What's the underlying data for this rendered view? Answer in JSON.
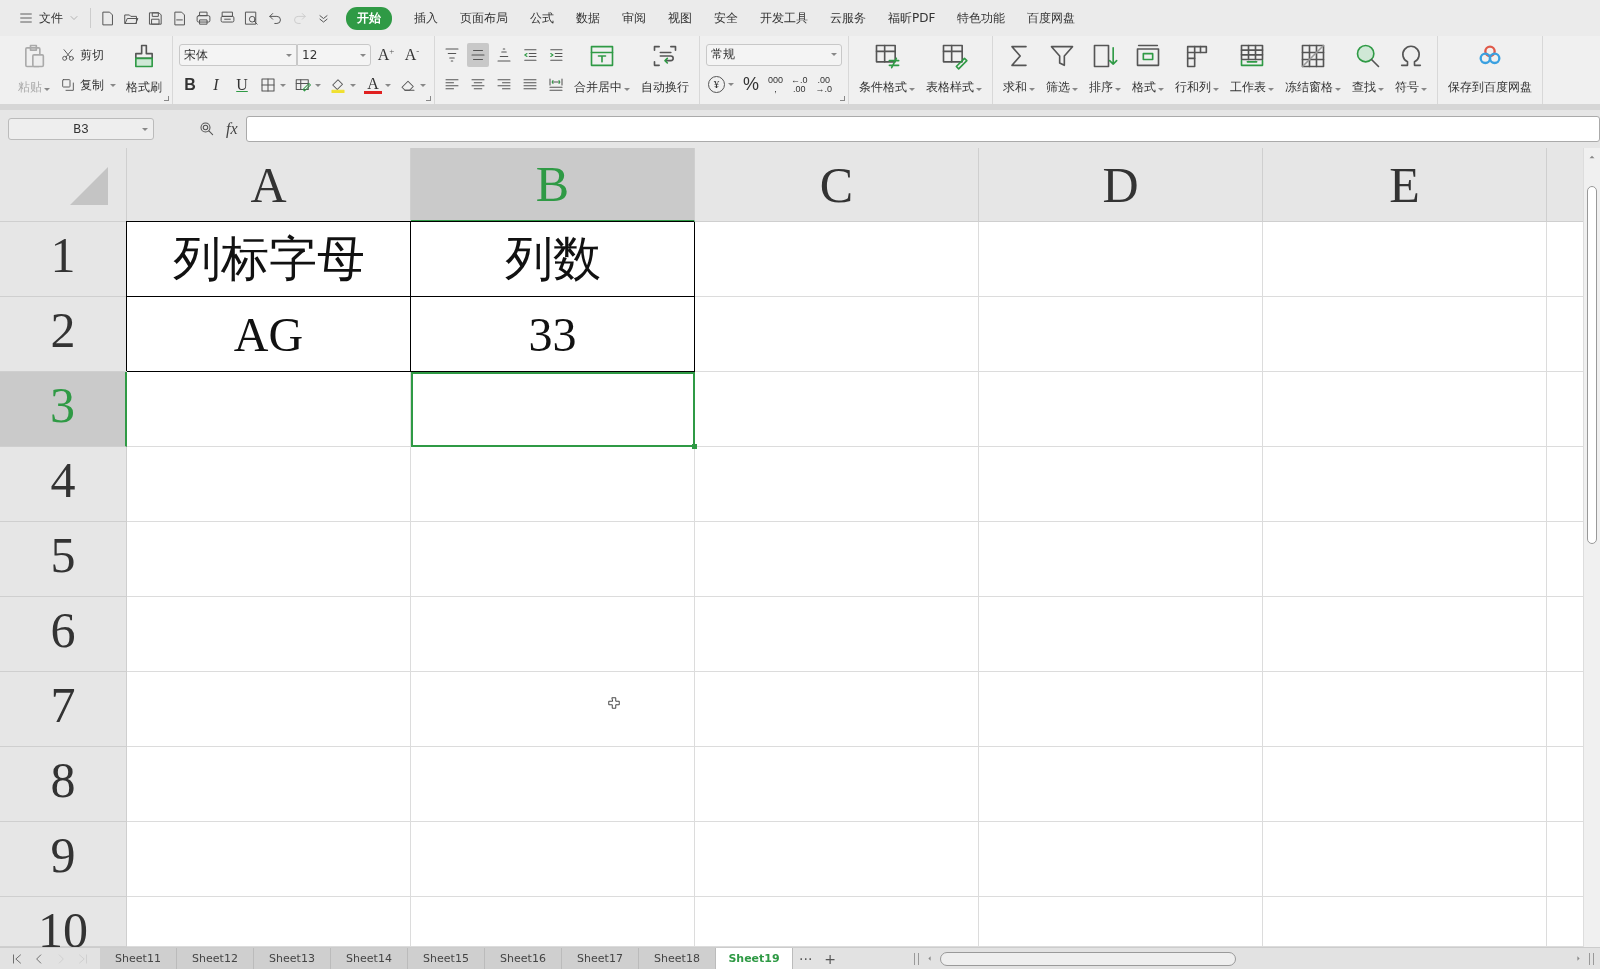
{
  "menu": {
    "file": "文件",
    "tabs": [
      {
        "label": "开始",
        "selected": true
      },
      {
        "label": "插入",
        "selected": false
      },
      {
        "label": "页面布局",
        "selected": false
      },
      {
        "label": "公式",
        "selected": false
      },
      {
        "label": "数据",
        "selected": false
      },
      {
        "label": "审阅",
        "selected": false
      },
      {
        "label": "视图",
        "selected": false
      },
      {
        "label": "安全",
        "selected": false
      },
      {
        "label": "开发工具",
        "selected": false
      },
      {
        "label": "云服务",
        "selected": false
      },
      {
        "label": "福昕PDF",
        "selected": false
      },
      {
        "label": "特色功能",
        "selected": false
      },
      {
        "label": "百度网盘",
        "selected": false
      }
    ]
  },
  "ribbon": {
    "groups": [
      {
        "launcher": true,
        "cols": [
          {
            "kind": "large",
            "label": "粘贴",
            "dropdown": true,
            "disabled": true
          },
          {
            "kind": "stack",
            "rows": [
              [
                {
                  "kind": "button",
                  "label": "剪切",
                  "dropdown": false
                }
              ],
              [
                {
                  "kind": "button",
                  "label": "复制",
                  "dropdown": true
                }
              ]
            ]
          },
          {
            "kind": "large",
            "label": "格式刷",
            "dropdown": false,
            "disabled": false
          }
        ]
      },
      {
        "launcher": true,
        "cols": [
          {
            "kind": "stack",
            "rows": [
              [
                {
                  "kind": "select",
                  "value": "宋体"
                },
                {
                  "kind": "select",
                  "value": "12"
                },
                {
                  "kind": "glyph",
                  "label": "A$^{+}$",
                  "dropdown": false
                },
                {
                  "kind": "glyph",
                  "label": "A$^{-}$",
                  "dropdown": false
                }
              ],
              [
                {
                  "kind": "bold",
                  "label": "B",
                  "dropdown": false
                },
                {
                  "kind": "italic",
                  "label": "I",
                  "dropdown": false
                },
                {
                  "kind": "underline",
                  "label": "U",
                  "dropdown": false
                },
                {
                  "kind": "tool",
                  "dropdown": true
                },
                {
                  "kind": "tool",
                  "dropdown": true
                },
                {
                  "kind": "tool",
                  "dropdown": true
                },
                {
                  "kind": "font-color",
                  "label": "A",
                  "dropdown": true
                },
                {
                  "kind": "tool",
                  "dropdown": true
                }
              ]
            ]
          }
        ]
      },
      {
        "cols": [
          {
            "kind": "stack",
            "rows": [
              [
                {
                  "kind": "tool",
                  "dropdown": false,
                  "pressed": false
                },
                {
                  "kind": "tool",
                  "dropdown": false,
                  "pressed": true
                },
                {
                  "kind": "tool",
                  "dropdown": false,
                  "pressed": false
                },
                {
                  "kind": "tool",
                  "dropdown": false,
                  "pressed": false
                },
                {
                  "kind": "tool",
                  "dropdown": false,
                  "pressed": false
                }
              ],
              [
                {
                  "kind": "tool",
                  "dropdown": false,
                  "pressed": false
                },
                {
                  "kind": "tool",
                  "dropdown": false,
                  "pressed": false
                },
                {
                  "kind": "tool",
                  "dropdown": false,
                  "pressed": false
                },
                {
                  "kind": "tool",
                  "dropdown": false,
                  "pressed": false
                },
                {
                  "kind": "tool",
                  "dropdown": false,
                  "pressed": false
                }
              ]
            ]
          },
          {
            "kind": "large",
            "label": "合并居中",
            "dropdown": true,
            "disabled": false
          },
          {
            "kind": "large",
            "label": "自动换行",
            "dropdown": false,
            "disabled": false
          }
        ]
      },
      {
        "launcher": true,
        "cols": [
          {
            "kind": "stack",
            "rows": [
              [
                {
                  "kind": "select",
                  "value": "常规"
                }
              ],
              [
                {
                  "kind": "currency",
                  "label": "¥",
                  "dropdown": true
                },
                {
                  "kind": "percent",
                  "label": "%",
                  "dropdown": false
                },
                {
                  "kind": "lines",
                  "lines": [
                    "000",
                    ","
                  ]
                },
                {
                  "kind": "lines",
                  "lines": [
                    "←.0",
                    ".00"
                  ]
                },
                {
                  "kind": "lines",
                  "lines": [
                    ".00",
                    "→.0"
                  ]
                }
              ]
            ]
          }
        ]
      },
      {
        "cols": [
          {
            "kind": "large",
            "label": "条件格式",
            "dropdown": true,
            "disabled": false
          },
          {
            "kind": "large",
            "label": "表格样式",
            "dropdown": true,
            "disabled": false
          }
        ]
      },
      {
        "cols": [
          {
            "kind": "large",
            "label": "求和",
            "dropdown": true,
            "disabled": false
          },
          {
            "kind": "large",
            "label": "筛选",
            "dropdown": true,
            "disabled": false
          },
          {
            "kind": "large",
            "label": "排序",
            "dropdown": true,
            "disabled": false
          },
          {
            "kind": "large",
            "label": "格式",
            "dropdown": true,
            "disabled": false
          },
          {
            "kind": "large",
            "label": "行和列",
            "dropdown": true,
            "disabled": false
          },
          {
            "kind": "large",
            "label": "工作表",
            "dropdown": true,
            "disabled": false
          },
          {
            "kind": "large",
            "label": "冻结窗格",
            "dropdown": true,
            "disabled": false
          },
          {
            "kind": "large",
            "label": "查找",
            "dropdown": true,
            "disabled": false
          },
          {
            "kind": "large",
            "label": "符号",
            "dropdown": true,
            "disabled": false
          }
        ]
      },
      {
        "cols": [
          {
            "kind": "large",
            "label": "保存到百度网盘",
            "dropdown": false,
            "disabled": false
          }
        ]
      }
    ]
  },
  "formula_bar": {
    "name_box": "B3",
    "fx": "fx"
  },
  "sheet": {
    "columns": [
      {
        "label": "A",
        "selected": false
      },
      {
        "label": "B",
        "selected": true
      },
      {
        "label": "C",
        "selected": false
      },
      {
        "label": "D",
        "selected": false
      },
      {
        "label": "E",
        "selected": false
      }
    ],
    "rows": [
      {
        "label": "1",
        "selected": false,
        "cells": [
          {
            "text": "列标字母",
            "bordered": true
          },
          {
            "text": "列数",
            "bordered": true
          }
        ]
      },
      {
        "label": "2",
        "selected": false,
        "cells": [
          {
            "text": "AG",
            "bordered": true
          },
          {
            "text": "33",
            "bordered": true
          }
        ]
      },
      {
        "label": "3",
        "selected": true
      },
      {
        "label": "4",
        "selected": false
      },
      {
        "label": "5",
        "selected": false
      },
      {
        "label": "6",
        "selected": false
      },
      {
        "label": "7",
        "selected": false
      },
      {
        "label": "8",
        "selected": false
      },
      {
        "label": "9",
        "selected": false
      },
      {
        "label": "10",
        "selected": false
      }
    ]
  },
  "sheet_tabs": {
    "tabs": [
      {
        "label": "Sheet11",
        "selected": false
      },
      {
        "label": "Sheet12",
        "selected": false
      },
      {
        "label": "Sheet13",
        "selected": false
      },
      {
        "label": "Sheet14",
        "selected": false
      },
      {
        "label": "Sheet15",
        "selected": false
      },
      {
        "label": "Sheet16",
        "selected": false
      },
      {
        "label": "Sheet17",
        "selected": false
      },
      {
        "label": "Sheet18",
        "selected": false
      },
      {
        "label": "Sheet19",
        "selected": true
      }
    ],
    "more": "···",
    "add": "+"
  }
}
